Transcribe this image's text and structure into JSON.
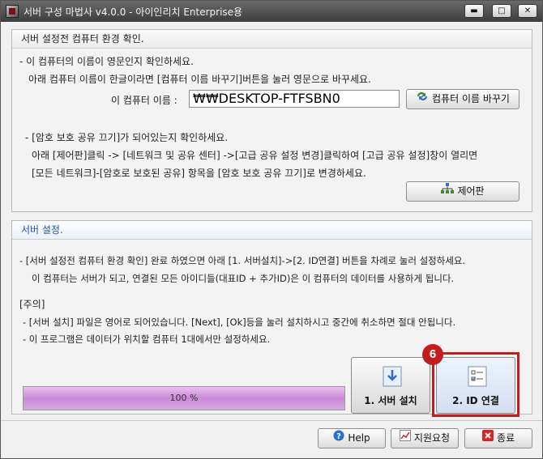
{
  "window": {
    "title": "서버 구성 마법사 v4.0.0 - 아이인리치 Enterprise용",
    "controls": {
      "minimize": "▬",
      "maximize": "□",
      "close": "✕"
    }
  },
  "env_panel": {
    "header": "서버 설정전 컴퓨터 환경 확인.",
    "line1": "- 이 컴퓨터의 이름이 영문인지 확인하세요.",
    "line2": "아래 컴퓨터 이름이 한글이라면 [컴퓨터 이름 바꾸기]버튼을 눌러 영문으로 바꾸세요.",
    "computer_name_label": "이 컴퓨터 이름 :",
    "computer_name_value": "₩₩DESKTOP-FTFSBN0",
    "rename_button": "컴퓨터 이름 바꾸기",
    "line3": "- [암호 보호 공유 끄기]가 되어있는지 확인하세요.",
    "line4": "아래 [제어판]클릭 -> [네트워크 및 공유 센터] ->[고급 공유 설정 변경]클릭하여 [고급 공유 설정]창이 열리면",
    "line5": "[모든 네트워크]-[암호로 보호된 공유] 항목을 [암호 보호 공유 끄기]로 변경하세요.",
    "control_panel_button": "제어판"
  },
  "server_panel": {
    "header": "서버 설정.",
    "line1": "- [서버 설정전 컴퓨터 환경 확인] 완료 하였으면 아래 [1. 서버설치]->[2. ID연결] 버튼을 차례로 눌러 설정하세요.",
    "line2": "이 컴퓨터는 서버가 되고, 연결된 모든 아이디들(대표ID + 추가ID)은 이 컴퓨터의 데이터를 사용하게 됩니다.",
    "notice_title": "[주의]",
    "notice1": "- [서버 설치] 파일은 영어로 되어있습니다. [Next], [Ok]등을 눌러 설치하시고 중간에 취소하면 절대 안됩니다.",
    "notice2": "- 이 프로그램은 데이터가 위치할 컴퓨터 1대에서만 설정하세요.",
    "progress_label": "100 %",
    "progress_value": 1.0,
    "install_button": "1. 서버 설치",
    "connect_button": "2. ID 연결",
    "step_badge": "6"
  },
  "footer": {
    "help_button": "Help",
    "support_button": "지원요청",
    "exit_button": "종료"
  },
  "colors": {
    "highlight": "#c21d1d",
    "progress_fill": "#c98ad6",
    "header_blue": "#1e55b8"
  }
}
